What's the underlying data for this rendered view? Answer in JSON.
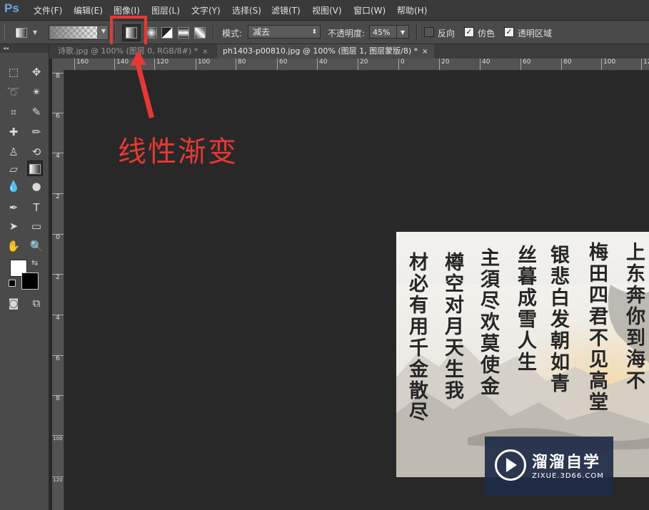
{
  "app": {
    "logo": "Ps"
  },
  "menu": [
    "文件(F)",
    "编辑(E)",
    "图像(I)",
    "图层(L)",
    "文字(Y)",
    "选择(S)",
    "滤镜(T)",
    "视图(V)",
    "窗口(W)",
    "帮助(H)"
  ],
  "options": {
    "mode_label": "模式:",
    "mode_value": "减去",
    "opacity_label": "不透明度:",
    "opacity_value": "45%",
    "reverse_label": "反向",
    "reverse_checked": false,
    "dither_label": "仿色",
    "dither_checked": true,
    "transparency_label": "透明区域",
    "transparency_checked": true
  },
  "tabs": [
    {
      "label": "诗歌.jpg @ 100% (图层 0, RGB/8#) *",
      "close": "×",
      "active": false
    },
    {
      "label": "ph1403-p00810.jpg @ 100% (图层 1, 图层蒙版/8) *",
      "close": "×",
      "active": true
    }
  ],
  "ruler": {
    "h_labels": [
      "160",
      "140",
      "120",
      "100",
      "80",
      "60",
      "40",
      "20",
      "0",
      "20",
      "40",
      "60",
      "80",
      "100",
      "120"
    ],
    "v_labels": [
      "8",
      "6",
      "4",
      "2",
      "0",
      "2",
      "4",
      "6",
      "8",
      "100",
      "120"
    ]
  },
  "annotation": {
    "text": "线性渐变",
    "color": "#e53935"
  },
  "document": {
    "columns": [
      "上东奔你到海不",
      "梅田四君不见高堂",
      "银悲白发朝如青",
      "丝暮成雪人生",
      "主須尽欢莫使金",
      "樽空对月天生我",
      "材必有用千金散尽"
    ]
  },
  "watermark": {
    "title": "溜溜自学",
    "subtitle": "ZIXUE.3D66.COM"
  },
  "colors": {
    "foreground": "#ffffff",
    "background": "#000000",
    "highlight": "#e53935"
  }
}
